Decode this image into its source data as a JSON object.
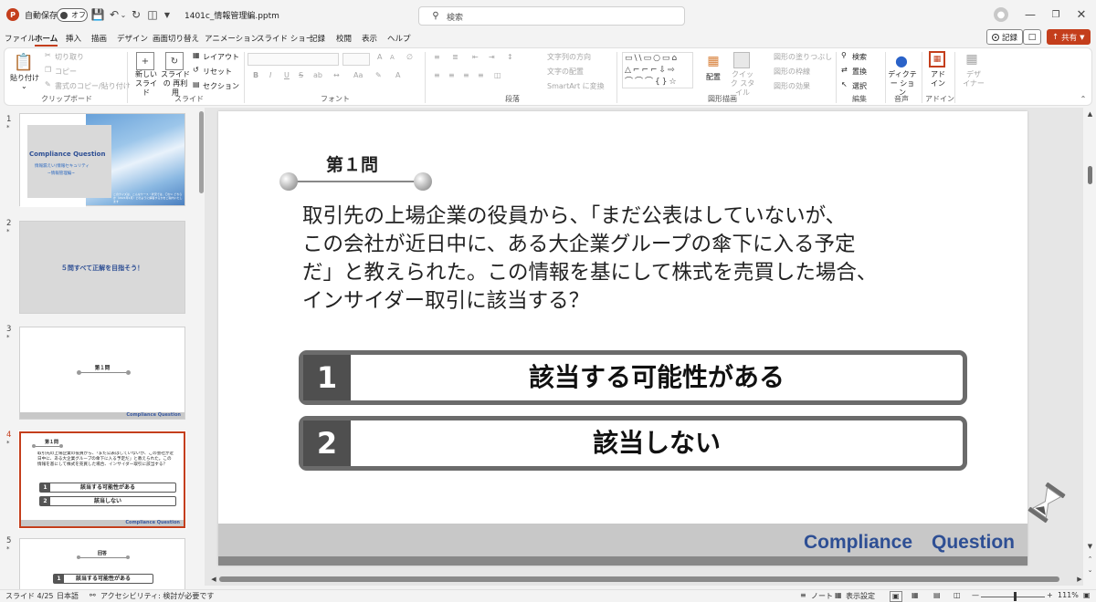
{
  "titlebar": {
    "autosave_label": "自動保存",
    "autosave_state": "オフ",
    "filename": "1401c_情報管理編.pptm",
    "search_placeholder": "検索"
  },
  "menu_tabs": [
    "ファイル",
    "ホーム",
    "挿入",
    "描画",
    "デザイン",
    "画面切り替え",
    "アニメーション",
    "スライド ショー",
    "記録",
    "校閲",
    "表示",
    "ヘルプ"
  ],
  "active_tab": "ホーム",
  "top_right": {
    "record": "記録",
    "share": "共有"
  },
  "ribbon": {
    "clipboard": {
      "paste": "貼り付け",
      "cut": "切り取り",
      "copy": "コピー",
      "format_painter": "書式のコピー/貼り付け",
      "group": "クリップボード"
    },
    "slides": {
      "new_slide": "新しい スライド",
      "reuse": "スライドの 再利用",
      "layout": "レイアウト",
      "reset": "リセット",
      "section": "セクション",
      "group": "スライド"
    },
    "font": {
      "group": "フォント",
      "bold": "B",
      "italic": "I",
      "underline": "U",
      "strike": "S",
      "font_size_a": "A"
    },
    "paragraph": {
      "text_direction": "文字列の方向",
      "align_text": "文字の配置",
      "smartart": "SmartArt に変換",
      "group": "段落"
    },
    "drawing": {
      "arrange": "配置",
      "quick_styles": "クイック スタイル",
      "shape_fill": "図形の塗りつぶし",
      "shape_outline": "図形の枠線",
      "shape_effects": "図形の効果",
      "group": "図形描画"
    },
    "editing": {
      "find": "検索",
      "replace": "置換",
      "select": "選択",
      "group": "編集"
    },
    "voice": {
      "dictate": "ディクテー ション",
      "group": "音声"
    },
    "addins": {
      "addin": "アド イン",
      "group": "アドイン"
    },
    "designer": {
      "label": "デザ イナー"
    }
  },
  "thumbnails": [
    {
      "num": "1",
      "title": "Compliance Question",
      "sub1": "情報漏えい(情報セキュリティ",
      "sub2": "~情報管理編~",
      "note": "このクイズは、こんなケース・状況では、〇か× どちらか（2021年1月）どのように解答するかをご案内いたします"
    },
    {
      "num": "2",
      "text": "５問すべて正解を目指そう！"
    },
    {
      "num": "3",
      "title": "第１問",
      "footer": "Compliance   Question"
    },
    {
      "num": "4",
      "title": "第１問",
      "q": "取引先の上場企業の役員から、「まだ公表はしていないが、この会社が近日中に、ある大企業グループの傘下に入る予定だ」と教えられた。この情報を基にして株式を売買した場合、インサイダー取引に該当する？",
      "opt1": "該当する可能性がある",
      "opt2": "該当しない",
      "footer": "Compliance   Question"
    },
    {
      "num": "5",
      "title": "回答",
      "opt1": "該当する可能性がある"
    }
  ],
  "slide": {
    "question_title": "第１問",
    "question_lines": [
      "取引先の上場企業の役員から、「まだ公表はしていないが、",
      "この会社が近日中に、ある大企業グループの傘下に入る予定",
      "だ」と教えられた。この情報を基にして株式を売買した場合、",
      "インサイダー取引に該当する？"
    ],
    "options": [
      {
        "num": "1",
        "label": "該当する可能性がある"
      },
      {
        "num": "2",
        "label": "該当しない"
      }
    ],
    "footer": "Compliance　Question"
  },
  "status": {
    "slide_counter": "スライド 4/25",
    "language": "日本語",
    "accessibility": "アクセシビリティ: 検討が必要です",
    "notes": "ノート",
    "display_settings": "表示設定",
    "zoom": "111%"
  }
}
